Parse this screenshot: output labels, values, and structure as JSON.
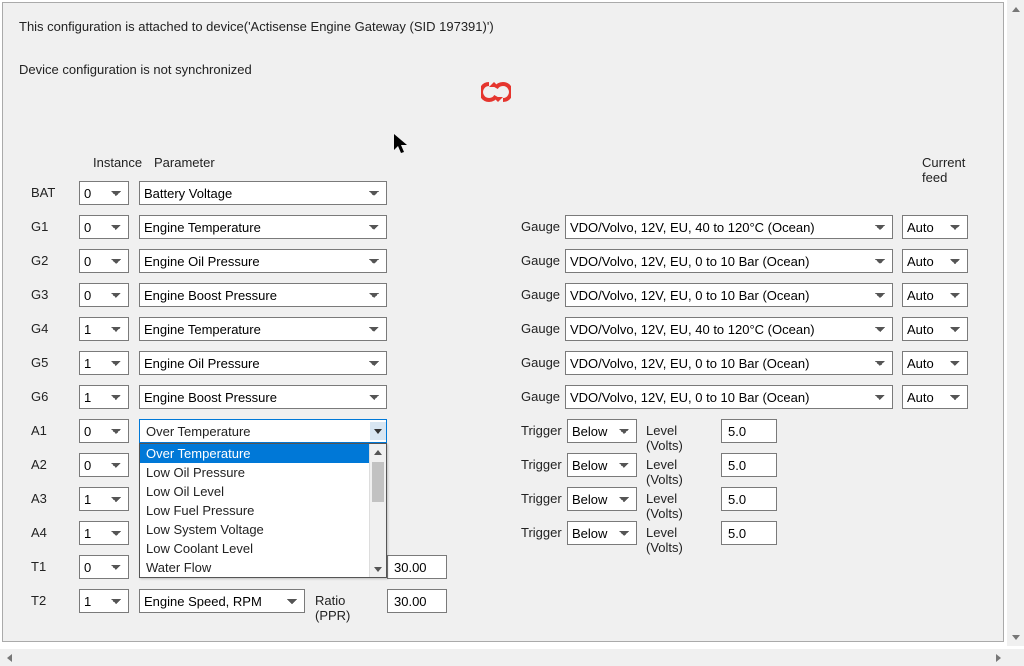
{
  "header": {
    "attached_text": "This configuration is attached to device('Actisense Engine Gateway (SID 197391)')",
    "sync_text": "Device configuration is not synchronized"
  },
  "columns": {
    "instance": "Instance",
    "parameter": "Parameter",
    "current_feed": "Current feed"
  },
  "labels": {
    "gauge": "Gauge",
    "trigger": "Trigger",
    "level": "Level (Volts)",
    "ratio": "Ratio (PPR)"
  },
  "rows": {
    "BAT": {
      "label": "BAT",
      "instance": "0",
      "parameter": "Battery Voltage"
    },
    "G1": {
      "label": "G1",
      "instance": "0",
      "parameter": "Engine Temperature",
      "gauge": "VDO/Volvo, 12V, EU, 40 to 120°C (Ocean)",
      "feed": "Auto"
    },
    "G2": {
      "label": "G2",
      "instance": "0",
      "parameter": "Engine Oil Pressure",
      "gauge": "VDO/Volvo, 12V, EU, 0 to 10 Bar (Ocean)",
      "feed": "Auto"
    },
    "G3": {
      "label": "G3",
      "instance": "0",
      "parameter": "Engine Boost Pressure",
      "gauge": "VDO/Volvo, 12V, EU, 0 to 10 Bar (Ocean)",
      "feed": "Auto"
    },
    "G4": {
      "label": "G4",
      "instance": "1",
      "parameter": "Engine Temperature",
      "gauge": "VDO/Volvo, 12V, EU, 40 to 120°C (Ocean)",
      "feed": "Auto"
    },
    "G5": {
      "label": "G5",
      "instance": "1",
      "parameter": "Engine Oil Pressure",
      "gauge": "VDO/Volvo, 12V, EU, 0 to 10 Bar (Ocean)",
      "feed": "Auto"
    },
    "G6": {
      "label": "G6",
      "instance": "1",
      "parameter": "Engine Boost Pressure",
      "gauge": "VDO/Volvo, 12V, EU, 0 to 10 Bar (Ocean)",
      "feed": "Auto"
    },
    "A1": {
      "label": "A1",
      "instance": "0",
      "parameter": "Over Temperature",
      "trigger": "Below",
      "level": "5.0"
    },
    "A2": {
      "label": "A2",
      "instance": "0",
      "trigger": "Below",
      "level": "5.0"
    },
    "A3": {
      "label": "A3",
      "instance": "1",
      "trigger": "Below",
      "level": "5.0"
    },
    "A4": {
      "label": "A4",
      "instance": "1",
      "trigger": "Below",
      "level": "5.0"
    },
    "T1": {
      "label": "T1",
      "instance": "0",
      "ratio": "30.00"
    },
    "T2": {
      "label": "T2",
      "instance": "1",
      "parameter": "Engine Speed, RPM",
      "ratio": "30.00"
    }
  },
  "dropdown_open": {
    "selected": "Over Temperature",
    "options": [
      "Over Temperature",
      "Low Oil Pressure",
      "Low Oil Level",
      "Low Fuel Pressure",
      "Low System Voltage",
      "Low Coolant Level",
      "Water Flow"
    ]
  },
  "colors": {
    "sync_icon": "#e5352e",
    "highlight": "#0078d7",
    "panel_bg": "#f0f0f0"
  }
}
